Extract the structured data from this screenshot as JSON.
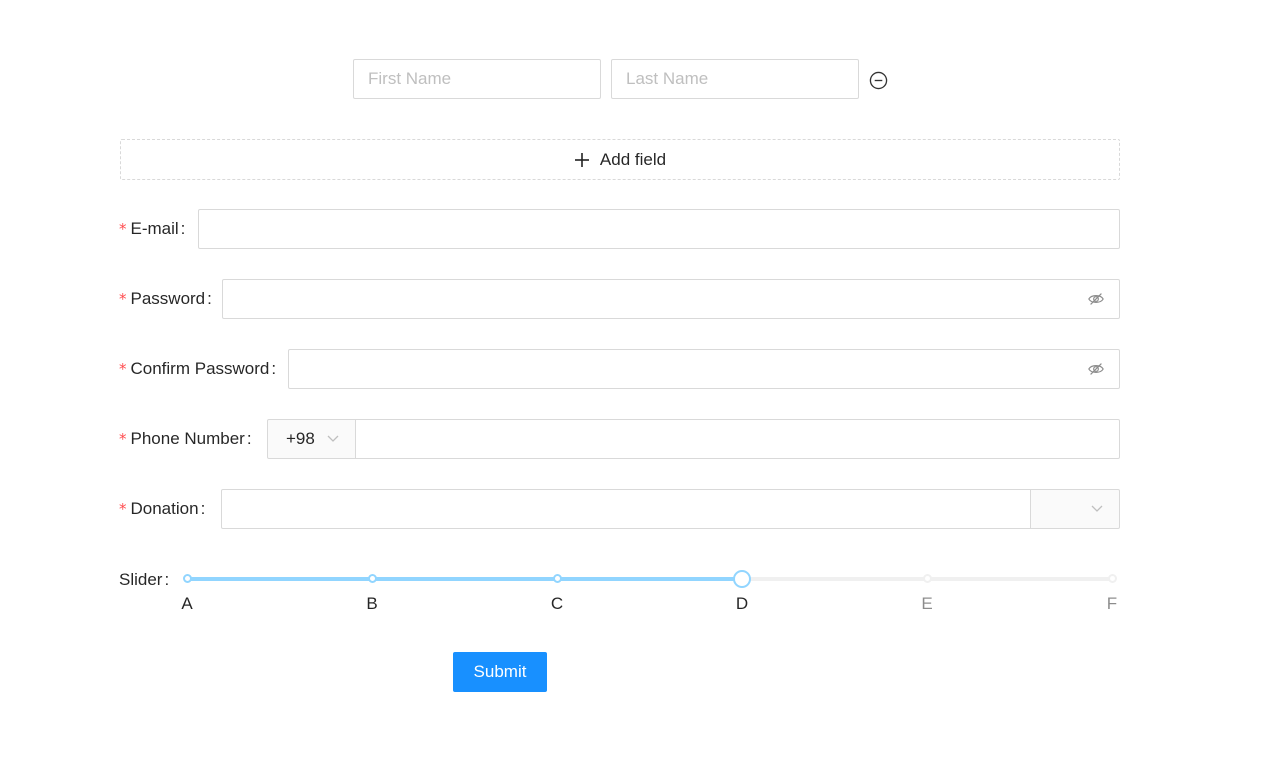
{
  "name_row": {
    "first_name_placeholder": "First Name",
    "last_name_placeholder": "Last Name",
    "remove_icon": "minus-circle-icon"
  },
  "add_field": {
    "label": "Add field",
    "icon": "plus-icon"
  },
  "form": {
    "required_mark": "*",
    "colon": ":",
    "email": {
      "label": "E-mail",
      "value": ""
    },
    "password": {
      "label": "Password",
      "value": "",
      "toggle_icon": "eye-invisible-icon"
    },
    "confirm_password": {
      "label": "Confirm Password",
      "value": "",
      "toggle_icon": "eye-invisible-icon"
    },
    "phone": {
      "label": "Phone Number",
      "prefix": "+98",
      "value": ""
    },
    "donation": {
      "label": "Donation",
      "value": "",
      "suffix_icon": "chevron-down-icon"
    },
    "slider": {
      "label": "Slider",
      "marks": [
        "A",
        "B",
        "C",
        "D",
        "E",
        "F"
      ],
      "value_index": 3
    },
    "submit_label": "Submit"
  },
  "colors": {
    "primary": "#1890ff",
    "slider_active": "#91d5ff",
    "required": "#ff4d4f",
    "border": "#d9d9d9"
  }
}
